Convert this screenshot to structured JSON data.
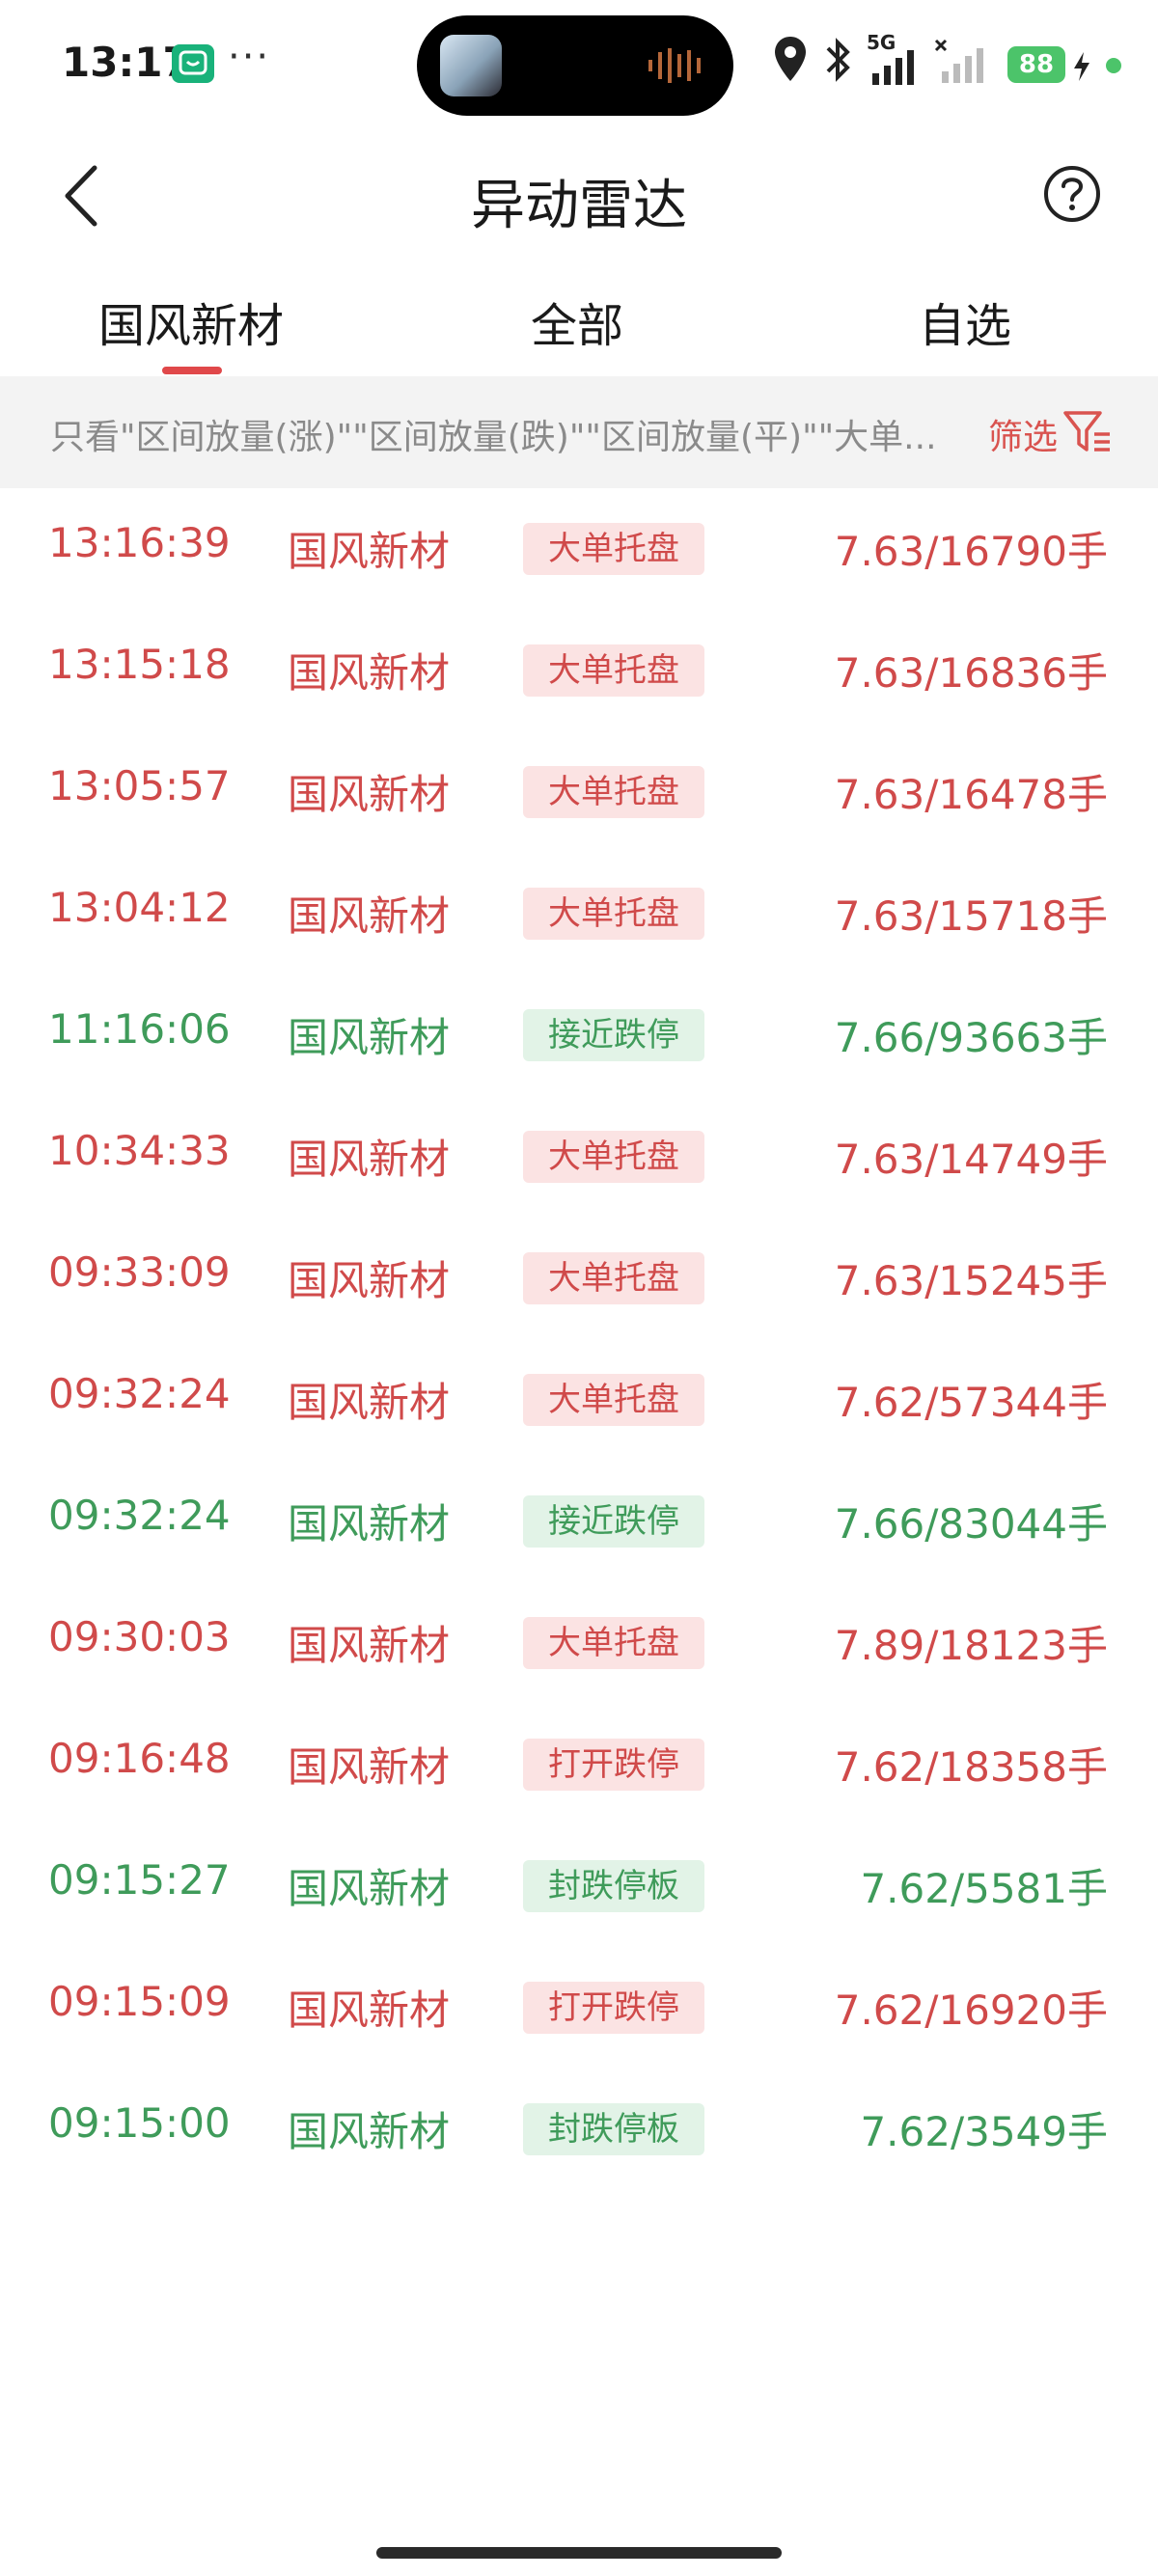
{
  "status_bar": {
    "time": "13:17",
    "app_icon_label": "",
    "dots": "···",
    "network_label": "5G",
    "battery": "88"
  },
  "header": {
    "title": "异动雷达"
  },
  "tabs": [
    {
      "label": "国风新材",
      "active": true
    },
    {
      "label": "全部",
      "active": false
    },
    {
      "label": "自选",
      "active": false
    }
  ],
  "filter": {
    "text": "只看\"区间放量(涨)\"\"区间放量(跌)\"\"区间放量(平)\"\"大单...",
    "button_label": "筛选"
  },
  "colors": {
    "up": "#d04a4a",
    "down": "#3f9b5a",
    "accent": "#e0484a"
  },
  "rows": [
    {
      "time": "13:16:39",
      "name": "国风新材",
      "tag": "大单托盘",
      "value": "7.63/16790手",
      "dir": "up"
    },
    {
      "time": "13:15:18",
      "name": "国风新材",
      "tag": "大单托盘",
      "value": "7.63/16836手",
      "dir": "up"
    },
    {
      "time": "13:05:57",
      "name": "国风新材",
      "tag": "大单托盘",
      "value": "7.63/16478手",
      "dir": "up"
    },
    {
      "time": "13:04:12",
      "name": "国风新材",
      "tag": "大单托盘",
      "value": "7.63/15718手",
      "dir": "up"
    },
    {
      "time": "11:16:06",
      "name": "国风新材",
      "tag": "接近跌停",
      "value": "7.66/93663手",
      "dir": "down"
    },
    {
      "time": "10:34:33",
      "name": "国风新材",
      "tag": "大单托盘",
      "value": "7.63/14749手",
      "dir": "up"
    },
    {
      "time": "09:33:09",
      "name": "国风新材",
      "tag": "大单托盘",
      "value": "7.63/15245手",
      "dir": "up"
    },
    {
      "time": "09:32:24",
      "name": "国风新材",
      "tag": "大单托盘",
      "value": "7.62/57344手",
      "dir": "up"
    },
    {
      "time": "09:32:24",
      "name": "国风新材",
      "tag": "接近跌停",
      "value": "7.66/83044手",
      "dir": "down"
    },
    {
      "time": "09:30:03",
      "name": "国风新材",
      "tag": "大单托盘",
      "value": "7.89/18123手",
      "dir": "up"
    },
    {
      "time": "09:16:48",
      "name": "国风新材",
      "tag": "打开跌停",
      "value": "7.62/18358手",
      "dir": "up"
    },
    {
      "time": "09:15:27",
      "name": "国风新材",
      "tag": "封跌停板",
      "value": "7.62/5581手",
      "dir": "down"
    },
    {
      "time": "09:15:09",
      "name": "国风新材",
      "tag": "打开跌停",
      "value": "7.62/16920手",
      "dir": "up"
    },
    {
      "time": "09:15:00",
      "name": "国风新材",
      "tag": "封跌停板",
      "value": "7.62/3549手",
      "dir": "down"
    }
  ]
}
